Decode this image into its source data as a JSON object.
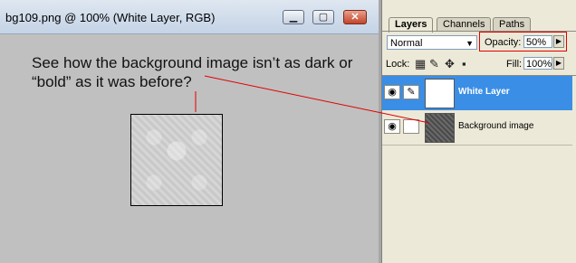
{
  "document": {
    "title": "bg109.png @ 100% (White Layer, RGB)",
    "window_buttons": {
      "minimize": "▁",
      "maximize": "▢",
      "close": "✕"
    },
    "callout": [
      "See how the background image isn’t as dark or",
      "“bold” as it was before?"
    ]
  },
  "panel": {
    "tabs": [
      "Layers",
      "Channels",
      "Paths"
    ],
    "active_tab": "Layers",
    "blend_mode": "Normal",
    "opacity_label": "Opacity:",
    "opacity_value": "50%",
    "lock_label": "Lock:",
    "fill_label": "Fill:",
    "fill_value": "100%",
    "layers": [
      {
        "name": "White Layer",
        "selected": true
      },
      {
        "name": "Background image",
        "selected": false
      }
    ]
  },
  "colors": {
    "annotation_line": "#e00000",
    "selected_layer": "#3a8ee6"
  }
}
